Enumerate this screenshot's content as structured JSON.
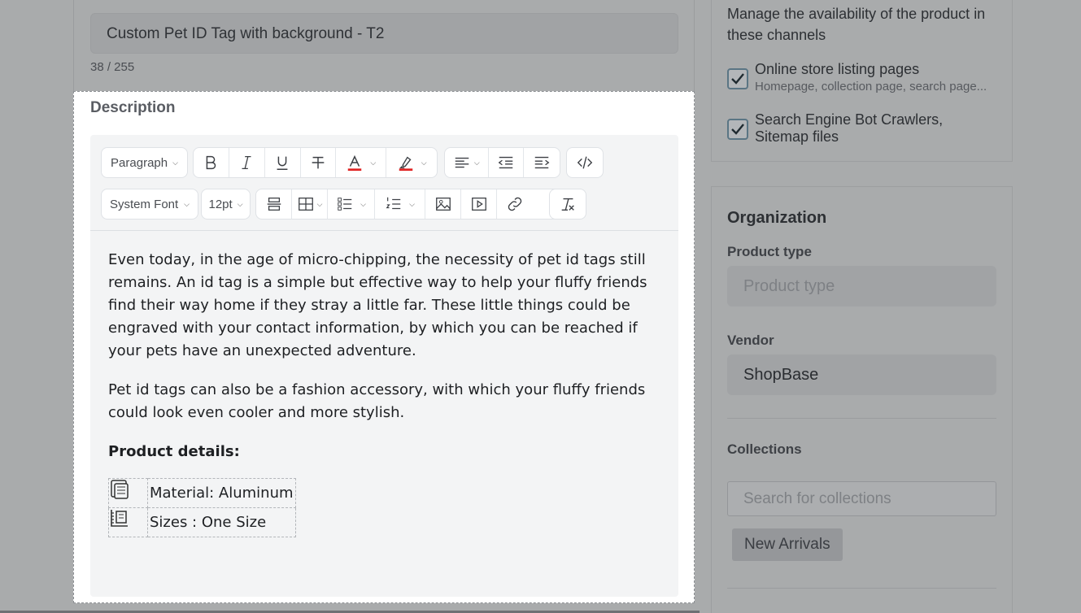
{
  "product": {
    "title_value": "Custom Pet ID Tag with background - T2",
    "title_char_count": "38 / 255"
  },
  "description": {
    "label": "Description",
    "toolbar": {
      "block_format": "Paragraph",
      "font_family": "System Font",
      "font_size": "12pt"
    },
    "content": {
      "paragraph_1": "Even today, in the age of micro-chipping, the necessity of pet id tags still remains. An id tag is a simple but effective way to help your fluffy friends find their way home if they stray a little far. These little things could be engraved with your contact information, by which you can be reached if your pets have an unexpected adventure.",
      "paragraph_2": "Pet id tags can also be a fashion accessory, with which your fluffy friends could look even cooler and more stylish.",
      "details_heading": "Product details:",
      "details": [
        {
          "icon": "chip-icon",
          "text": "Material: Aluminum"
        },
        {
          "icon": "size-icon",
          "text": "Sizes : One Size"
        }
      ]
    }
  },
  "channels": {
    "intro": "Manage the availability of the product in these channels",
    "items": [
      {
        "label": "Online store listing pages",
        "sublabel": "Homepage, collection page, search page...",
        "checked": true
      },
      {
        "label": "Search Engine Bot Crawlers, Sitemap files",
        "checked": true
      }
    ]
  },
  "organization": {
    "title": "Organization",
    "product_type_label": "Product type",
    "product_type_placeholder": "Product type",
    "vendor_label": "Vendor",
    "vendor_value": "ShopBase",
    "collections_label": "Collections",
    "collections_search_placeholder": "Search for collections",
    "collections": [
      "New Arrivals"
    ]
  },
  "colors": {
    "overlay_gray": "#a9abac",
    "highlight_white": "#ffffff",
    "text_color_red": "#e02424"
  }
}
